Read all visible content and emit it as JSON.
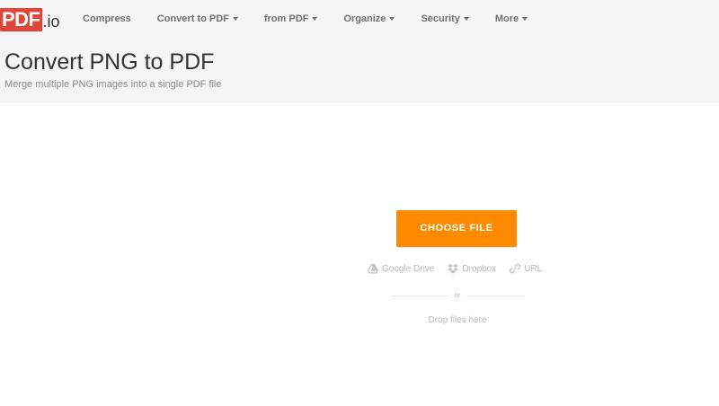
{
  "brand": {
    "logo_text": "PDF",
    "logo_suffix": ".io",
    "logo_color": "#e0453a"
  },
  "nav": {
    "items": [
      {
        "label": "Compress",
        "has_dropdown": false
      },
      {
        "label": "Convert to PDF",
        "has_dropdown": true
      },
      {
        "label": "from PDF",
        "has_dropdown": true
      },
      {
        "label": "Organize",
        "has_dropdown": true
      },
      {
        "label": "Security",
        "has_dropdown": true
      },
      {
        "label": "More",
        "has_dropdown": true
      }
    ]
  },
  "header": {
    "title": "Convert PNG to PDF",
    "subtitle": "Merge multiple PNG images into a single PDF file"
  },
  "upload": {
    "choose_button": "CHOOSE FILE",
    "button_color": "#ff8a00",
    "sources": [
      {
        "label": "Google Drive",
        "icon": "google-drive-icon"
      },
      {
        "label": "Dropbox",
        "icon": "dropbox-icon"
      },
      {
        "label": "URL",
        "icon": "link-icon"
      }
    ],
    "or_text": "or",
    "drop_text": "Drop files here"
  }
}
